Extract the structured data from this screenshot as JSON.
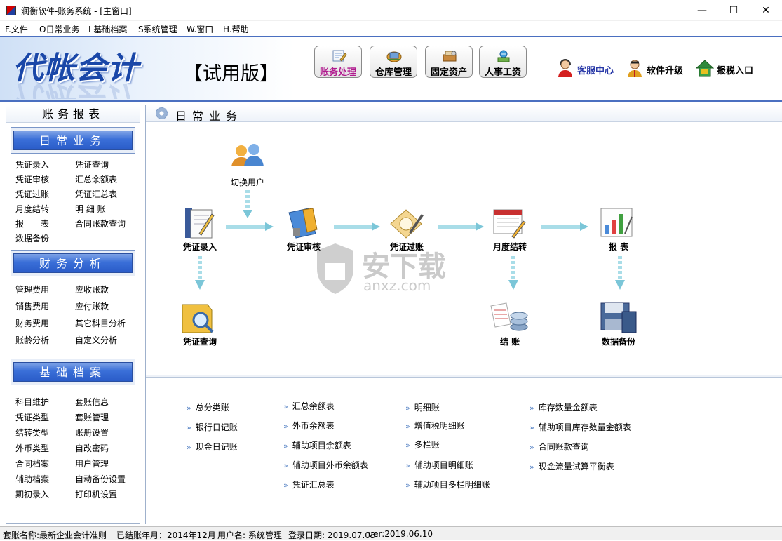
{
  "window": {
    "title": "润衡软件-账务系统 - [主窗口]",
    "controls": {
      "minimize": "—",
      "maximize": "☐",
      "close": "✕"
    }
  },
  "menu": [
    "F.文件",
    "O日常业务",
    "I 基础档案",
    "S系统管理",
    "W.窗口",
    "H.帮助"
  ],
  "banner": {
    "logo": "代帐会计",
    "edition": "【试用版】",
    "tools": [
      {
        "label": "账务处理",
        "icon": "ledger-icon",
        "active": true
      },
      {
        "label": "仓库管理",
        "icon": "warehouse-icon",
        "active": false
      },
      {
        "label": "固定资产",
        "icon": "assets-icon",
        "active": false
      },
      {
        "label": "人事工资",
        "icon": "payroll-icon",
        "active": false
      }
    ],
    "links": [
      {
        "label": "客服中心",
        "icon": "customer-service-icon",
        "color": "#2a3aa8"
      },
      {
        "label": "软件升级",
        "icon": "upgrade-icon",
        "color": "#000000"
      },
      {
        "label": "报税入口",
        "icon": "tax-icon",
        "color": "#000000"
      }
    ]
  },
  "sidebar": {
    "title": "账务报表",
    "sections": [
      {
        "title": "日常业务",
        "items": [
          "凭证录入",
          "凭证查询",
          "凭证审核",
          "汇总余额表",
          "凭证过账",
          "凭证汇总表",
          "月度结转",
          "明 细 账",
          "报　　表",
          "合同账款查询",
          "数据备份"
        ]
      },
      {
        "title": "财务分析",
        "items": [
          "管理费用",
          "应收账款",
          "销售费用",
          "应付账款",
          "财务费用",
          "其它科目分析",
          "账龄分析",
          "自定义分析"
        ]
      },
      {
        "title": "基础档案",
        "items": [
          "科目维护",
          "套账信息",
          "凭证类型",
          "套账管理",
          "结转类型",
          "账册设置",
          "外币类型",
          "自改密码",
          "合同档案",
          "用户管理",
          "辅助档案",
          "自动备份设置",
          "期初录入",
          "打印机设置"
        ]
      }
    ]
  },
  "main": {
    "title": "日常业务",
    "flow": {
      "switch_user": "切换用户",
      "voucher_entry": "凭证录入",
      "voucher_audit": "凭证审核",
      "voucher_post": "凭证过账",
      "month_close": "月度结转",
      "reports": "报  表",
      "voucher_query": "凭证查询",
      "closing": "结  账",
      "backup": "数据备份"
    },
    "report_links": [
      [
        "总分类账",
        "银行日记账",
        "现金日记账"
      ],
      [
        "汇总余额表",
        "外币余额表",
        "辅助项目余额表",
        "辅助项目外币余额表",
        "凭证汇总表"
      ],
      [
        "明细账",
        "增值税明细账",
        "多栏账",
        "辅助项目明细账",
        "辅助项目多栏明细账"
      ],
      [
        "库存数量金额表",
        "辅助项目库存数量金额表",
        "合同账款查询",
        "现金流量试算平衡表"
      ]
    ],
    "watermark": {
      "text": "安下载",
      "sub": "anxz.com"
    }
  },
  "status": {
    "account_name": "套账名称:最新企业会计准则",
    "closed_month": "已结账年月：2014年12月",
    "user": "用户名: 系统管理",
    "login_date": "登录日期: 2019.07.03",
    "version": "ver:2019.06.10"
  },
  "colors": {
    "accent": "#2a5cc8",
    "active_tool": "#b01a8e",
    "link_bullet": "#4a7ac0"
  }
}
